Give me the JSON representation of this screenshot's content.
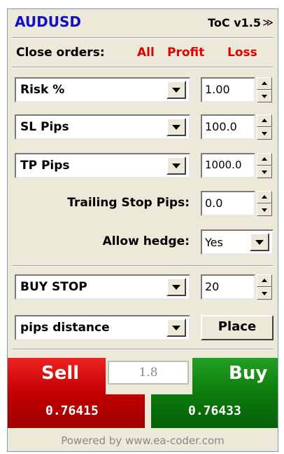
{
  "header": {
    "symbol": "AUDUSD",
    "version": "ToC v1.5",
    "collapse_glyph": "≫"
  },
  "close_orders": {
    "label": "Close orders:",
    "all": "All",
    "profit": "Profit",
    "loss": "Loss"
  },
  "rows": {
    "risk": {
      "select": "Risk %",
      "value": "1.00"
    },
    "sl": {
      "select": "SL Pips",
      "value": "100.0"
    },
    "tp": {
      "select": "TP Pips",
      "value": "1000.0"
    },
    "trailing": {
      "label": "Trailing Stop Pips:",
      "value": "0.0"
    },
    "hedge": {
      "label": "Allow hedge:",
      "value": "Yes"
    }
  },
  "pending": {
    "order_type": "BUY STOP",
    "distance": "20",
    "distance_mode": "pips distance",
    "place_label": "Place"
  },
  "trade": {
    "sell_label": "Sell",
    "buy_label": "Buy",
    "spread": "1.8",
    "bid": "0.76415",
    "ask": "0.76433"
  },
  "footer": "Powered by www.ea-coder.com",
  "colors": {
    "link_red": "#e00000",
    "symbol_blue": "#1010c8",
    "sell_red": "#c00000",
    "buy_green": "#0b7a0b"
  }
}
